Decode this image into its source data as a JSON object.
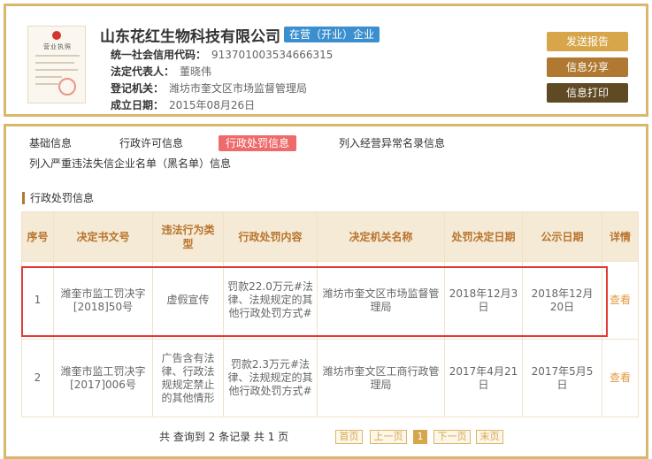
{
  "company": {
    "name": "山东花红生物科技有限公司",
    "status": "在营（开业）企业",
    "license_thumb_title": "营业执照",
    "fields": [
      {
        "label": "统一社会信用代码：",
        "value": "913701003534666315"
      },
      {
        "label": "法定代表人：",
        "value": "董晓伟"
      },
      {
        "label": "登记机关：",
        "value": "潍坊市奎文区市场监督管理局"
      },
      {
        "label": "成立日期：",
        "value": "2015年08月26日"
      }
    ]
  },
  "actions": {
    "report": "发送报告",
    "share": "信息分享",
    "print": "信息打印"
  },
  "tabs": [
    {
      "label": "基础信息",
      "active": false
    },
    {
      "label": "行政许可信息",
      "active": false
    },
    {
      "label": "行政处罚信息",
      "active": true
    },
    {
      "label": "列入经营异常名录信息",
      "active": false
    },
    {
      "label": "列入严重违法失信企业名单（黑名单）信息",
      "active": false
    }
  ],
  "section": {
    "title": "行政处罚信息"
  },
  "table": {
    "headers": [
      "序号",
      "决定书文号",
      "违法行为类型",
      "行政处罚内容",
      "决定机关名称",
      "处罚决定日期",
      "公示日期",
      "详情"
    ],
    "rows": [
      {
        "index": "1",
        "doc_no": "潍奎市监工罚决字[2018]50号",
        "violation": "虚假宣传",
        "content": "罚款22.0万元#法律、法规规定的其他行政处罚方式#",
        "authority": "潍坊市奎文区市场监督管理局",
        "decision_date": "2018年12月3日",
        "publish_date": "2018年12月20日",
        "detail": "查看",
        "highlighted": true
      },
      {
        "index": "2",
        "doc_no": "潍奎市监工罚决字[2017]006号",
        "violation": "广告含有法律、行政法规规定禁止的其他情形",
        "content": "罚款2.3万元#法律、法规规定的其他行政处罚方式#",
        "authority": "潍坊市奎文区工商行政管理局",
        "decision_date": "2017年4月21日",
        "publish_date": "2017年5月5日",
        "detail": "查看",
        "highlighted": false
      }
    ]
  },
  "pagination": {
    "summary": "共 查询到 2 条记录 共 1 页",
    "first": "首页",
    "prev": "上一页",
    "current": "1",
    "next": "下一页",
    "last": "末页"
  },
  "colors": {
    "border_gold": "#d9b86c",
    "active_tab": "#ef6a6a",
    "status_badge": "#3b8fcf",
    "header_text": "#b8732b",
    "highlight_box": "#e53935"
  }
}
